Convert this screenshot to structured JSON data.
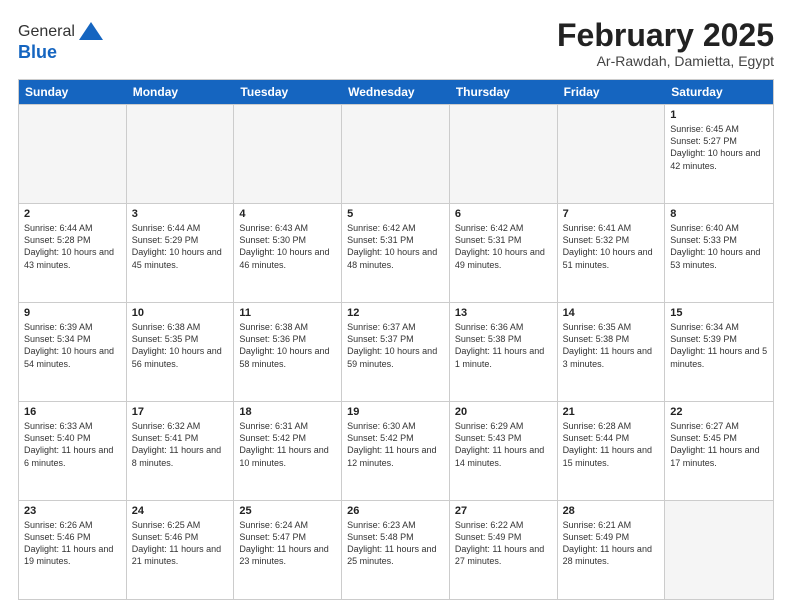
{
  "logo": {
    "general": "General",
    "blue": "Blue"
  },
  "title": "February 2025",
  "location": "Ar-Rawdah, Damietta, Egypt",
  "days": [
    "Sunday",
    "Monday",
    "Tuesday",
    "Wednesday",
    "Thursday",
    "Friday",
    "Saturday"
  ],
  "weeks": [
    [
      {
        "day": "",
        "empty": true
      },
      {
        "day": "",
        "empty": true
      },
      {
        "day": "",
        "empty": true
      },
      {
        "day": "",
        "empty": true
      },
      {
        "day": "",
        "empty": true
      },
      {
        "day": "",
        "empty": true
      },
      {
        "day": "1",
        "sunrise": "6:45 AM",
        "sunset": "5:27 PM",
        "daylight": "10 hours and 42 minutes."
      }
    ],
    [
      {
        "day": "2",
        "sunrise": "6:44 AM",
        "sunset": "5:28 PM",
        "daylight": "10 hours and 43 minutes."
      },
      {
        "day": "3",
        "sunrise": "6:44 AM",
        "sunset": "5:29 PM",
        "daylight": "10 hours and 45 minutes."
      },
      {
        "day": "4",
        "sunrise": "6:43 AM",
        "sunset": "5:30 PM",
        "daylight": "10 hours and 46 minutes."
      },
      {
        "day": "5",
        "sunrise": "6:42 AM",
        "sunset": "5:31 PM",
        "daylight": "10 hours and 48 minutes."
      },
      {
        "day": "6",
        "sunrise": "6:42 AM",
        "sunset": "5:31 PM",
        "daylight": "10 hours and 49 minutes."
      },
      {
        "day": "7",
        "sunrise": "6:41 AM",
        "sunset": "5:32 PM",
        "daylight": "10 hours and 51 minutes."
      },
      {
        "day": "8",
        "sunrise": "6:40 AM",
        "sunset": "5:33 PM",
        "daylight": "10 hours and 53 minutes."
      }
    ],
    [
      {
        "day": "9",
        "sunrise": "6:39 AM",
        "sunset": "5:34 PM",
        "daylight": "10 hours and 54 minutes."
      },
      {
        "day": "10",
        "sunrise": "6:38 AM",
        "sunset": "5:35 PM",
        "daylight": "10 hours and 56 minutes."
      },
      {
        "day": "11",
        "sunrise": "6:38 AM",
        "sunset": "5:36 PM",
        "daylight": "10 hours and 58 minutes."
      },
      {
        "day": "12",
        "sunrise": "6:37 AM",
        "sunset": "5:37 PM",
        "daylight": "10 hours and 59 minutes."
      },
      {
        "day": "13",
        "sunrise": "6:36 AM",
        "sunset": "5:38 PM",
        "daylight": "11 hours and 1 minute."
      },
      {
        "day": "14",
        "sunrise": "6:35 AM",
        "sunset": "5:38 PM",
        "daylight": "11 hours and 3 minutes."
      },
      {
        "day": "15",
        "sunrise": "6:34 AM",
        "sunset": "5:39 PM",
        "daylight": "11 hours and 5 minutes."
      }
    ],
    [
      {
        "day": "16",
        "sunrise": "6:33 AM",
        "sunset": "5:40 PM",
        "daylight": "11 hours and 6 minutes."
      },
      {
        "day": "17",
        "sunrise": "6:32 AM",
        "sunset": "5:41 PM",
        "daylight": "11 hours and 8 minutes."
      },
      {
        "day": "18",
        "sunrise": "6:31 AM",
        "sunset": "5:42 PM",
        "daylight": "11 hours and 10 minutes."
      },
      {
        "day": "19",
        "sunrise": "6:30 AM",
        "sunset": "5:42 PM",
        "daylight": "11 hours and 12 minutes."
      },
      {
        "day": "20",
        "sunrise": "6:29 AM",
        "sunset": "5:43 PM",
        "daylight": "11 hours and 14 minutes."
      },
      {
        "day": "21",
        "sunrise": "6:28 AM",
        "sunset": "5:44 PM",
        "daylight": "11 hours and 15 minutes."
      },
      {
        "day": "22",
        "sunrise": "6:27 AM",
        "sunset": "5:45 PM",
        "daylight": "11 hours and 17 minutes."
      }
    ],
    [
      {
        "day": "23",
        "sunrise": "6:26 AM",
        "sunset": "5:46 PM",
        "daylight": "11 hours and 19 minutes."
      },
      {
        "day": "24",
        "sunrise": "6:25 AM",
        "sunset": "5:46 PM",
        "daylight": "11 hours and 21 minutes."
      },
      {
        "day": "25",
        "sunrise": "6:24 AM",
        "sunset": "5:47 PM",
        "daylight": "11 hours and 23 minutes."
      },
      {
        "day": "26",
        "sunrise": "6:23 AM",
        "sunset": "5:48 PM",
        "daylight": "11 hours and 25 minutes."
      },
      {
        "day": "27",
        "sunrise": "6:22 AM",
        "sunset": "5:49 PM",
        "daylight": "11 hours and 27 minutes."
      },
      {
        "day": "28",
        "sunrise": "6:21 AM",
        "sunset": "5:49 PM",
        "daylight": "11 hours and 28 minutes."
      },
      {
        "day": "",
        "empty": true
      }
    ]
  ]
}
